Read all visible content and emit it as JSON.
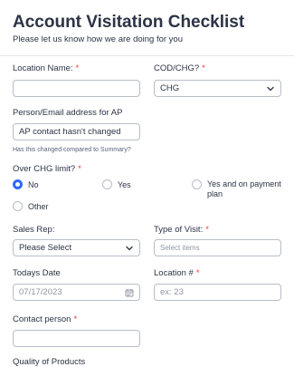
{
  "header": {
    "title": "Account Visitation Checklist",
    "subtitle": "Please let us know how we are doing for you"
  },
  "fields": {
    "location_name": {
      "label": "Location Name:",
      "required": "*",
      "value": ""
    },
    "cod_chg": {
      "label": "COD/CHG?",
      "required": "*",
      "value": "CHG"
    },
    "person_email": {
      "label": "Person/Email address for AP",
      "value": "AP contact hasn't changed",
      "sublabel": "Has this changed compared to Summary?"
    },
    "over_chg_limit": {
      "label": "Over CHG limit?",
      "required": "*",
      "options": [
        "No",
        "Yes",
        "Yes and on payment plan",
        "Other"
      ],
      "selected": "No"
    },
    "sales_rep": {
      "label": "Sales Rep:",
      "value": "Please Select"
    },
    "type_of_visit": {
      "label": "Type of Visit:",
      "required": "*",
      "placeholder": "Select items"
    },
    "todays_date": {
      "label": "Todays Date",
      "placeholder": "07/17/2023"
    },
    "location_num": {
      "label": "Location #",
      "required": "*",
      "placeholder": "ex: 23"
    },
    "contact_person": {
      "label": "Contact person",
      "required": "*",
      "value": ""
    },
    "next_field": {
      "label": "Quality of Products"
    }
  },
  "colors": {
    "accent": "#2e69ff",
    "required": "#f23a3c",
    "text": "#2c3345",
    "border": "#b8bdc9"
  },
  "icons": [
    "chevron-down-icon",
    "calendar-icon"
  ]
}
